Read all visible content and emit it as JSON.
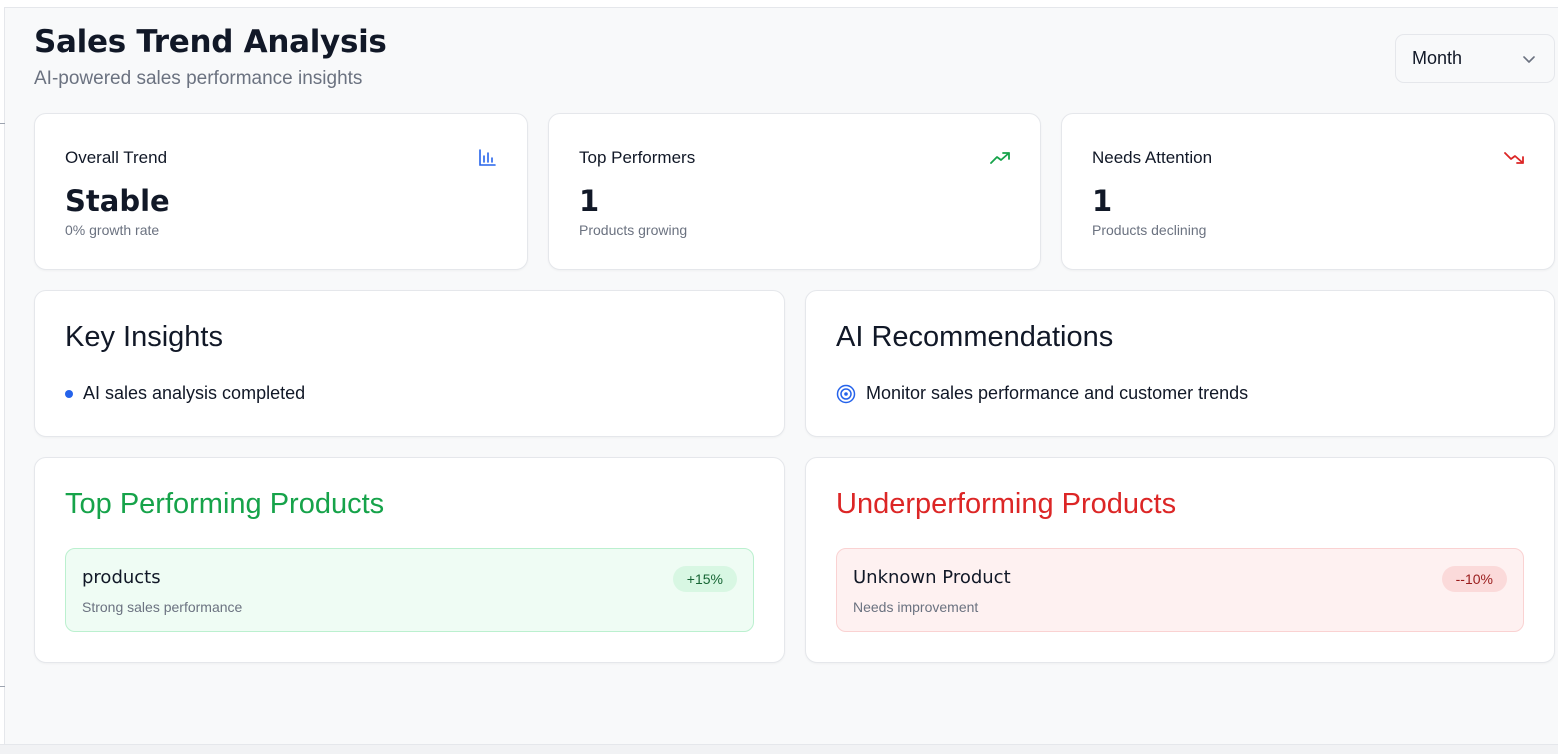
{
  "header": {
    "title": "Sales Trend Analysis",
    "subtitle": "AI-powered sales performance insights",
    "period_select": {
      "value": "Month",
      "icon": "chevron-down-icon"
    }
  },
  "stats": [
    {
      "label": "Overall Trend",
      "value": "Stable",
      "caption": "0% growth rate",
      "icon": "bar-chart-icon",
      "icon_color": "#2563eb"
    },
    {
      "label": "Top Performers",
      "value": "1",
      "caption": "Products growing",
      "icon": "trending-up-icon",
      "icon_color": "#16a34a"
    },
    {
      "label": "Needs Attention",
      "value": "1",
      "caption": "Products declining",
      "icon": "trending-down-icon",
      "icon_color": "#dc2626"
    }
  ],
  "insights": {
    "title": "Key Insights",
    "items": [
      "AI sales analysis completed"
    ]
  },
  "recommendations": {
    "title": "AI Recommendations",
    "items": [
      "Monitor sales performance and customer trends"
    ],
    "icon": "target-icon"
  },
  "top_products": {
    "title": "Top Performing Products",
    "items": [
      {
        "name": "products",
        "note": "Strong sales performance",
        "change": "+15%"
      }
    ]
  },
  "under_products": {
    "title": "Underperforming Products",
    "items": [
      {
        "name": "Unknown Product",
        "note": "Needs improvement",
        "change": "--10%"
      }
    ]
  },
  "colors": {
    "accent_blue": "#2563eb",
    "positive": "#16a34a",
    "negative": "#dc2626"
  }
}
